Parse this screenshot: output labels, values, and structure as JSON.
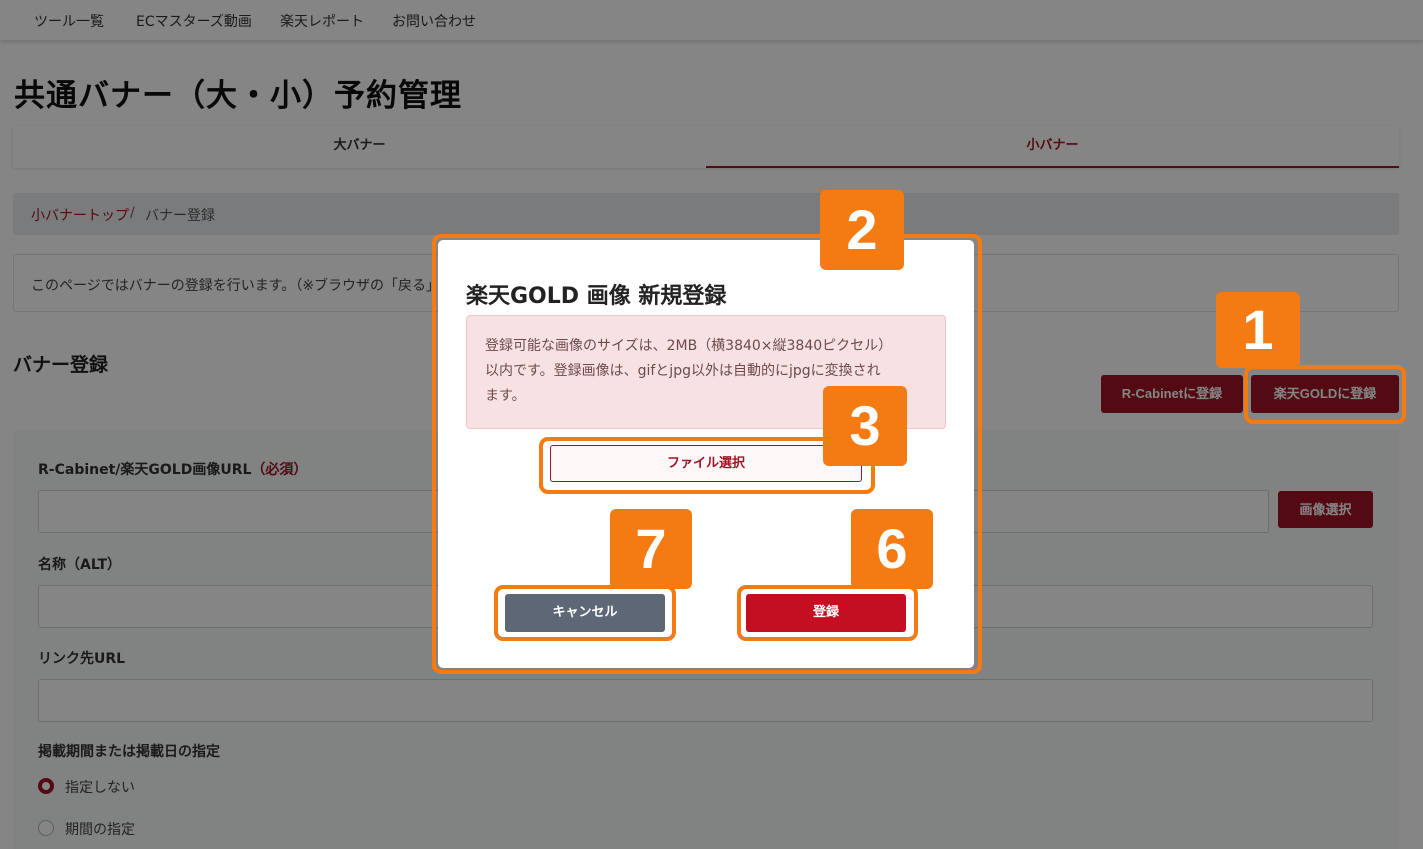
{
  "topnav": {
    "items": [
      "ツール一覧",
      "ECマスターズ動画",
      "楽天レポート",
      "お問い合わせ"
    ]
  },
  "page_title": "共通バナー（大・小）予約管理",
  "tabs": {
    "large": "大バナー",
    "small": "小バナー"
  },
  "breadcrumb": {
    "link": "小バナートップ",
    "separator": "/",
    "current": "バナー登録"
  },
  "info_text": "このページではバナーの登録を行います。（※ブラウザの「戻る」",
  "section_title": "バナー登録",
  "buttons": {
    "rcabinet": "R-Cabinetに登録",
    "gold": "楽天GOLDに登録",
    "image_select": "画像選択"
  },
  "form": {
    "url_label": "R-Cabinet/楽天GOLD画像URL",
    "url_required": "（必須）",
    "alt_label": "名称（ALT）",
    "link_label": "リンク先URL",
    "period_label": "掲載期間または掲載日の指定",
    "radio_none": "指定しない",
    "radio_period": "期間の指定"
  },
  "modal": {
    "title": "楽天GOLD 画像 新規登録",
    "alert_line1": "登録可能な画像のサイズは、2MB（横3840×縦3840ピクセル）",
    "alert_line2": "以内です。登録画像は、gifとjpg以外は自動的にjpgに変換され",
    "alert_line3": "ます。",
    "file_button": "ファイル選択",
    "cancel_button": "キャンセル",
    "register_button": "登録"
  },
  "annotations": {
    "b1": "1",
    "b2": "2",
    "b3": "3",
    "b6": "6",
    "b7": "7"
  },
  "colors": {
    "accent": "#a01424",
    "annotation": "#f47a12",
    "cancel": "#5d6776",
    "register": "#c40f23"
  }
}
